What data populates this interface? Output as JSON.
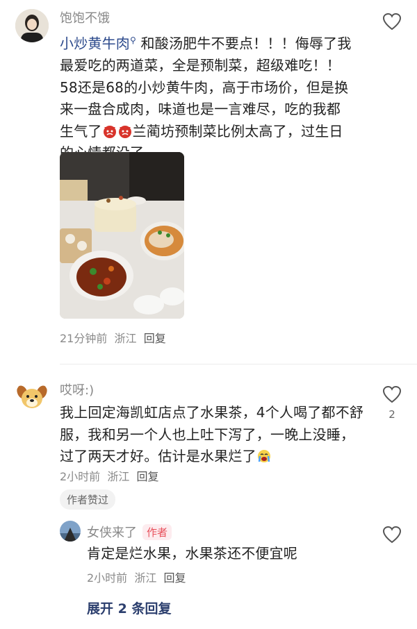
{
  "comments": [
    {
      "username": "饱饱不饿",
      "mention": "小炒黄牛肉",
      "text_after_mention": " 和酸汤肥牛不要点！！！侮辱了我最爱吃的两道菜，全是预制菜，超级难吃！！58还是68的小炒黄牛肉，高于市场价，但是换来一盘合成肉，味道也是一言难尽，吃的我都生气了",
      "text_tail": "兰蔺坊预制菜比例太高了，过生日的心情都没了。。。。",
      "time": "21分钟前",
      "location": "浙江",
      "reply_label": "回复"
    },
    {
      "username": "哎呀:)",
      "text": "我上回定海凯虹店点了水果茶，4个人喝了都不舒服，我和另一个人也上吐下泻了，一晚上没睡，过了两天才好。估计是水果烂了",
      "time": "2小时前",
      "location": "浙江",
      "reply_label": "回复",
      "like_count": "2",
      "author_liked": "作者赞过"
    }
  ],
  "reply": {
    "username": "女侠来了",
    "badge": "作者",
    "text": "肯定是烂水果，水果茶还不便宜呢",
    "time": "2小时前",
    "location": "浙江",
    "reply_label": "回复"
  },
  "expand_label": "展开 2 条回复",
  "colors": {
    "link": "#2c4a8c",
    "badge": "#e8505b"
  }
}
